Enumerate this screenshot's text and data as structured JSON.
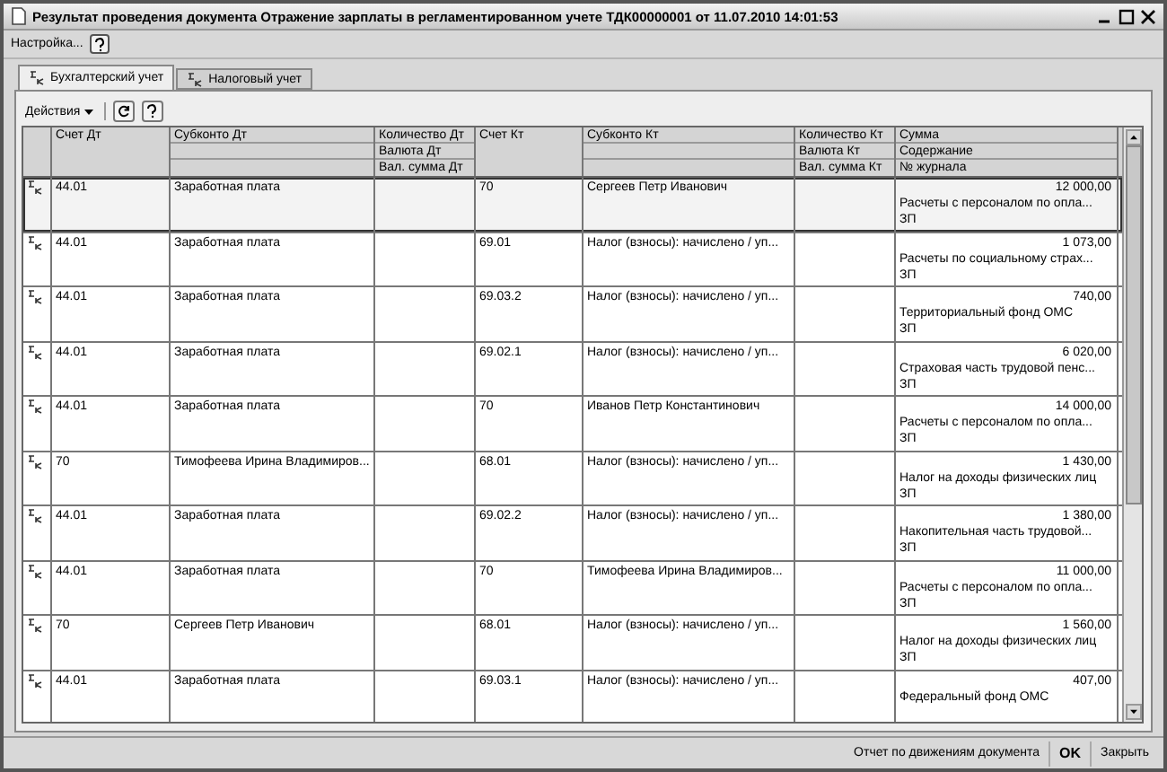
{
  "window": {
    "title": "Результат проведения документа Отражение зарплаты в регламентированном учете ТДК00000001 от 11.07.2010 14:01:53"
  },
  "menu": [
    {
      "label": "Настройка..."
    }
  ],
  "tabs": [
    {
      "label": "Бухгалтерский учет",
      "selected": true
    },
    {
      "label": "Налоговый учет",
      "selected": false
    }
  ],
  "toolbar": {
    "actions": "Действия"
  },
  "table": {
    "columns": [
      {
        "kind": "tall",
        "lines": [
          "Счет Дт"
        ]
      },
      {
        "kind": "stacked",
        "lines": [
          "Субконто Дт"
        ]
      },
      {
        "kind": "stacked",
        "lines": [
          "Количество Дт",
          "Валюта Дт",
          "Вал. сумма Дт"
        ]
      },
      {
        "kind": "tall",
        "lines": [
          "Счет Кт"
        ]
      },
      {
        "kind": "stacked",
        "lines": [
          "Субконто Кт"
        ]
      },
      {
        "kind": "stacked",
        "lines": [
          "Количество Кт",
          "Валюта Кт",
          "Вал. сумма Кт"
        ]
      },
      {
        "kind": "stacked",
        "lines": [
          "Сумма",
          "Содержание",
          "№ журнала"
        ]
      }
    ],
    "rows": [
      {
        "selected": true,
        "debit": "44.01",
        "subconto_dt": "Заработная плата",
        "credit": "70",
        "subconto_kt": "Сергеев Петр Иванович",
        "amount": "12 000,00",
        "content": "Расчеты с персоналом по опла...",
        "journal": "ЗП"
      },
      {
        "selected": false,
        "debit": "44.01",
        "subconto_dt": "Заработная плата",
        "credit": "69.01",
        "subconto_kt": "Налог (взносы): начислено / уп...",
        "amount": "1 073,00",
        "content": "Расчеты по социальному страх...",
        "journal": "ЗП"
      },
      {
        "selected": false,
        "debit": "44.01",
        "subconto_dt": "Заработная плата",
        "credit": "69.03.2",
        "subconto_kt": "Налог (взносы): начислено / уп...",
        "amount": "740,00",
        "content": "Территориальный фонд ОМС",
        "journal": "ЗП"
      },
      {
        "selected": false,
        "debit": "44.01",
        "subconto_dt": "Заработная плата",
        "credit": "69.02.1",
        "subconto_kt": "Налог (взносы): начислено / уп...",
        "amount": "6 020,00",
        "content": "Страховая часть трудовой пенс...",
        "journal": "ЗП"
      },
      {
        "selected": false,
        "debit": "44.01",
        "subconto_dt": "Заработная плата",
        "credit": "70",
        "subconto_kt": "Иванов  Петр  Константинович",
        "amount": "14 000,00",
        "content": "Расчеты с персоналом по опла...",
        "journal": "ЗП"
      },
      {
        "selected": false,
        "debit": "70",
        "subconto_dt": "Тимофеева Ирина Владимиров...",
        "credit": "68.01",
        "subconto_kt": "Налог (взносы): начислено / уп...",
        "amount": "1 430,00",
        "content": "Налог на доходы физических лиц",
        "journal": "ЗП"
      },
      {
        "selected": false,
        "debit": "44.01",
        "subconto_dt": "Заработная плата",
        "credit": "69.02.2",
        "subconto_kt": "Налог (взносы): начислено / уп...",
        "amount": "1 380,00",
        "content": "Накопительная часть трудовой...",
        "journal": "ЗП"
      },
      {
        "selected": false,
        "debit": "44.01",
        "subconto_dt": "Заработная плата",
        "credit": "70",
        "subconto_kt": "Тимофеева Ирина Владимиров...",
        "amount": "11 000,00",
        "content": "Расчеты с персоналом по опла...",
        "journal": "ЗП"
      },
      {
        "selected": false,
        "debit": "70",
        "subconto_dt": "Сергеев Петр Иванович",
        "credit": "68.01",
        "subconto_kt": "Налог (взносы): начислено / уп...",
        "amount": "1 560,00",
        "content": "Налог на доходы физических лиц",
        "journal": "ЗП"
      },
      {
        "selected": false,
        "debit": "44.01",
        "subconto_dt": "Заработная плата",
        "credit": "69.03.1",
        "subconto_kt": "Налог (взносы): начислено / уп...",
        "amount": "407,00",
        "content": "Федеральный фонд ОМС"
      }
    ]
  },
  "footer": {
    "buttons": [
      {
        "label": "Отчет по движениям документа",
        "kind": "plain"
      },
      {
        "label": "OK",
        "kind": "default"
      },
      {
        "label": "Закрыть",
        "kind": "plain"
      }
    ]
  }
}
